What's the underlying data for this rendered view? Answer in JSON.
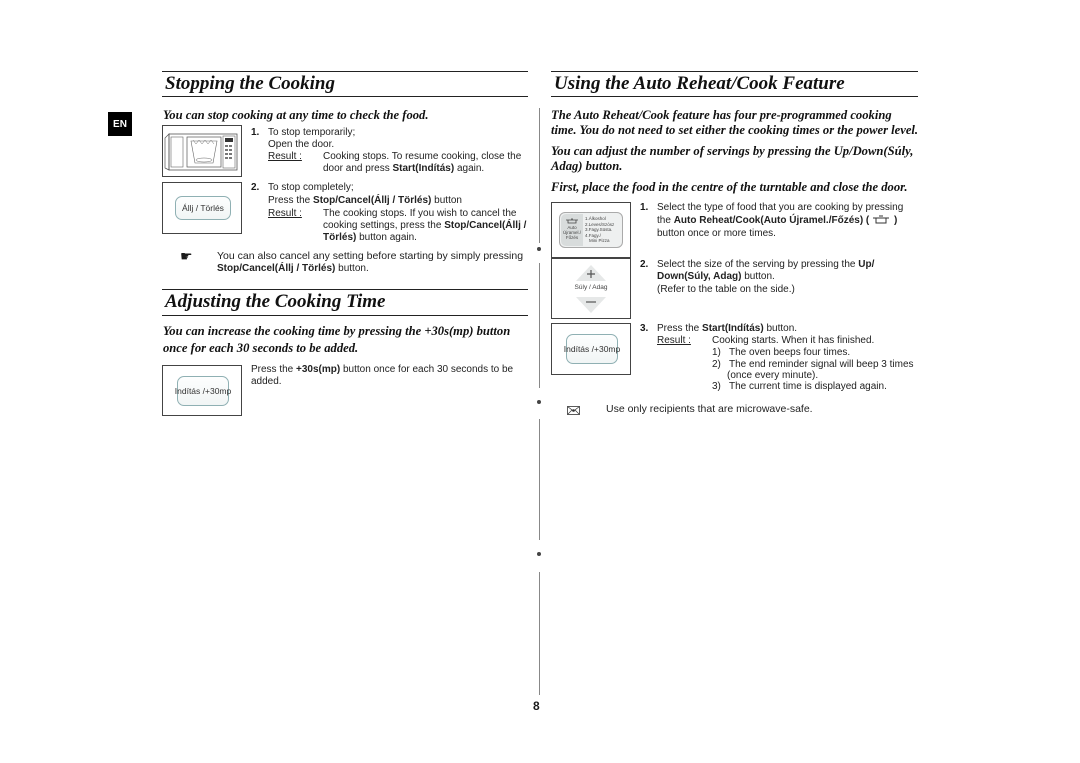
{
  "page": {
    "language_tab": "EN",
    "page_number": "8"
  },
  "left": {
    "stopping": {
      "title": "Stopping the Cooking",
      "lead": "You can stop cooking at any time to check the food.",
      "step1": {
        "num": "1.",
        "line1": "To stop temporarily;",
        "line2": "Open the door.",
        "result_label": "Result :",
        "result_a": "Cooking stops. To resume cooking, close the",
        "result_b_pre": "door and press ",
        "result_b_bold": "Start(Indítás)",
        "result_b_post": " again."
      },
      "step2": {
        "num": "2.",
        "line1": "To stop completely;",
        "line2_pre": "Press the ",
        "line2_bold": "Stop/Cancel(Állj / Törlés)",
        "line2_post": " button",
        "result_label": "Result :",
        "result_a": "The cooking stops. If you wish to cancel the",
        "result_b_pre": "cooking settings, press the ",
        "result_b_bold": "Stop/Cancel(Állj /",
        "result_c_bold": "Törlés)",
        "result_c_post": " button again."
      },
      "stop_button_label": "Állj / Törlés",
      "note_icon": "pointing-hand-icon",
      "note_line1": "You can also cancel any setting before starting by simply pressing",
      "note_line2_bold": "Stop/Cancel(Állj / Törlés)",
      "note_line2_post": " button."
    },
    "adjusting": {
      "title": "Adjusting the Cooking Time",
      "lead_line1": "You can increase the cooking time by pressing the +30s(mp) button",
      "lead_line2": "once for each 30 seconds to be added.",
      "text_pre": "Press the ",
      "text_bold": "+30s(mp)",
      "text_post": " button once for each 30 seconds to be",
      "text_line2": "added.",
      "button_label": "Indítás /+30mp"
    }
  },
  "right": {
    "title": "Using the Auto Reheat/Cook Feature",
    "lead1_line1": "The Auto Reheat/Cook feature has four pre-programmed cooking",
    "lead1_line2": "time. You do not need to set either the cooking times or the power level.",
    "lead2_line1": "You can adjust the number of servings by pressing the Up/Down(Súly,",
    "lead2_line2": "Adag) button.",
    "lead3": "First, place the food in the centre of the turntable and close the door.",
    "step1": {
      "num": "1.",
      "line1": "Select the type of food that you are cooking by pressing",
      "line2_pre": "the ",
      "line2_bold": "Auto Reheat/Cook(Auto Újramel./Főzés) (",
      "line2_post": " )",
      "line3": "button once or more times."
    },
    "auto_panel": {
      "button_label_1": "Auto",
      "button_label_2": "Újramel./",
      "button_label_3": "Főzés",
      "options": [
        "1.Álkoshol",
        "2.Leves/Szósz",
        "3.Fagy.Süsta.",
        "4.Fagy./",
        "Mini Pizza"
      ]
    },
    "step2": {
      "num": "2.",
      "line1_pre": "Select the size of the serving by pressing the ",
      "line1_bold": "Up/",
      "line2_bold": "Down(Súly, Adag)",
      "line2_post": " button.",
      "line3": "(Refer to the table on the side.)"
    },
    "updown_label": "Súly / Adag",
    "step3": {
      "num": "3.",
      "line1_pre": "Press the ",
      "line1_bold": "Start(Indítás)",
      "line1_post": "  button.",
      "result_label": "Result :",
      "result_line": "Cooking starts. When it has finished.",
      "sub": [
        {
          "n": "1)",
          "t": "The oven beeps four times."
        },
        {
          "n": "2)",
          "t": "The end reminder signal will beep 3 times"
        },
        {
          "n": "",
          "t": "(once every minute)."
        },
        {
          "n": "3)",
          "t": "The current time is displayed again."
        }
      ]
    },
    "start_button_label": "Indítás /+30mp",
    "note_icon": "warning-envelope-icon",
    "note_text": "Use only recipients that are microwave-safe."
  }
}
